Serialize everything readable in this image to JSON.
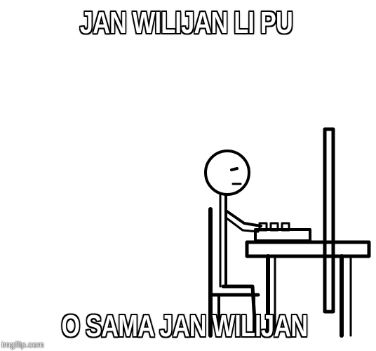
{
  "top_text": "JAN WILIJAN LI PU",
  "bottom_text": "O SAMA JAN WILIJAN",
  "watermark": "imgflip.com",
  "colors": {
    "text": "#ffffff",
    "outline": "#000000",
    "background": "#ffffff"
  }
}
